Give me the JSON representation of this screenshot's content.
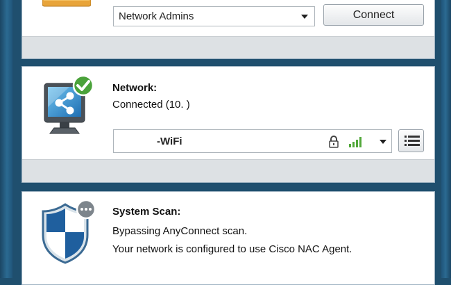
{
  "vpn": {
    "group_selected": "Network Admins",
    "connect_label": "Connect"
  },
  "network": {
    "title": "Network:",
    "status": "Connected (10.              )",
    "wifi_name": "-WiFi"
  },
  "system_scan": {
    "title": "System Scan:",
    "line1": "Bypassing AnyConnect scan.",
    "line2": "Your network is configured to use Cisco NAC Agent."
  },
  "colors": {
    "frame": "#1f4f6e",
    "panel_footer": "#dde1e4",
    "check_green": "#4aa23a",
    "signal_green": "#52a83a"
  },
  "icons": {
    "vpn": "vpn-lock-icon",
    "network": "network-monitor-icon",
    "connected_badge": "checkmark-icon",
    "scan": "shield-icon",
    "scan_badge": "ellipsis-icon",
    "wifi_lock": "lock-icon",
    "wifi_signal": "signal-bars-icon",
    "network_list": "list-icon"
  }
}
